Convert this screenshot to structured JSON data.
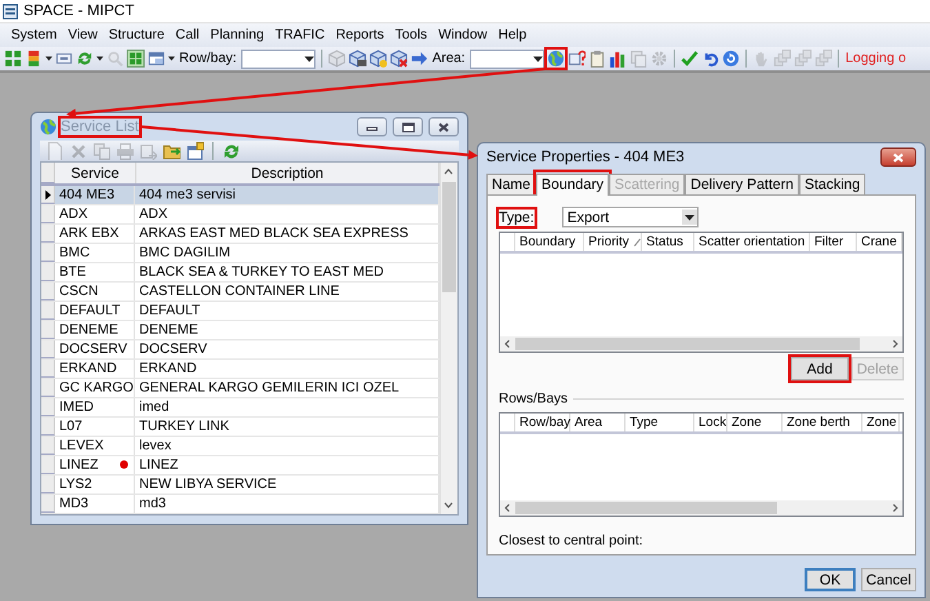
{
  "app": {
    "title": "SPACE - MIPCT"
  },
  "menu": [
    "System",
    "View",
    "Structure",
    "Call",
    "Planning",
    "TRAFIC",
    "Reports",
    "Tools",
    "Window",
    "Help"
  ],
  "toolbar": [
    {
      "kind": "icon",
      "disabled": false,
      "highlighted": false
    },
    {
      "kind": "icon",
      "disabled": false,
      "highlighted": false
    },
    {
      "kind": "caret"
    },
    {
      "kind": "icon",
      "disabled": false,
      "highlighted": false
    },
    {
      "kind": "icon",
      "disabled": false,
      "highlighted": false
    },
    {
      "kind": "caret"
    },
    {
      "kind": "icon",
      "disabled": true,
      "highlighted": false
    },
    {
      "kind": "icon",
      "disabled": false,
      "highlighted": false
    },
    {
      "kind": "icon",
      "disabled": false,
      "highlighted": false
    },
    {
      "kind": "caret"
    },
    {
      "kind": "label",
      "text": "Row/bay:"
    },
    {
      "kind": "combo"
    },
    {
      "kind": "separator"
    },
    {
      "kind": "icon",
      "disabled": true,
      "highlighted": false
    },
    {
      "kind": "icon",
      "disabled": false,
      "highlighted": false
    },
    {
      "kind": "icon",
      "disabled": false,
      "highlighted": false
    },
    {
      "kind": "icon",
      "disabled": false,
      "highlighted": false
    },
    {
      "kind": "icon",
      "disabled": false,
      "highlighted": false
    },
    {
      "kind": "label",
      "text": "Area:"
    },
    {
      "kind": "combo"
    },
    {
      "kind": "icon",
      "disabled": false,
      "highlighted": true
    },
    {
      "kind": "icon",
      "disabled": false,
      "highlighted": false
    },
    {
      "kind": "icon",
      "disabled": false,
      "highlighted": false
    },
    {
      "kind": "icon",
      "disabled": false,
      "highlighted": false
    },
    {
      "kind": "icon",
      "disabled": true,
      "highlighted": false
    },
    {
      "kind": "icon",
      "disabled": true,
      "highlighted": false
    },
    {
      "kind": "separator"
    },
    {
      "kind": "icon",
      "disabled": false,
      "highlighted": false
    },
    {
      "kind": "icon",
      "disabled": false,
      "highlighted": false
    },
    {
      "kind": "icon",
      "disabled": false,
      "highlighted": false
    },
    {
      "kind": "separator"
    },
    {
      "kind": "icon",
      "disabled": true,
      "highlighted": false
    },
    {
      "kind": "icon",
      "disabled": true,
      "highlighted": false
    },
    {
      "kind": "icon",
      "disabled": true,
      "highlighted": false
    },
    {
      "kind": "icon",
      "disabled": true,
      "highlighted": false
    },
    {
      "kind": "separator"
    },
    {
      "kind": "status",
      "text": "Logging o"
    }
  ],
  "service_list": {
    "title": "Service List",
    "title_highlighted": true,
    "toolbar": [
      {
        "kind": "icon",
        "disabled": true
      },
      {
        "kind": "icon",
        "disabled": true
      },
      {
        "kind": "icon",
        "disabled": true
      },
      {
        "kind": "icon",
        "disabled": true
      },
      {
        "kind": "icon",
        "disabled": true
      },
      {
        "kind": "icon",
        "disabled": false
      },
      {
        "kind": "icon",
        "disabled": false
      },
      {
        "kind": "separator"
      },
      {
        "kind": "icon",
        "disabled": false
      }
    ],
    "columns": [
      "Service",
      "Description"
    ],
    "rows": [
      {
        "service": "404 ME3",
        "description": "404 me3 servisi",
        "selected": true,
        "marked": false
      },
      {
        "service": "ADX",
        "description": "ADX",
        "selected": false,
        "marked": false
      },
      {
        "service": "ARK EBX",
        "description": "ARKAS EAST MED BLACK SEA EXPRESS",
        "selected": false,
        "marked": false
      },
      {
        "service": "BMC",
        "description": "BMC DAGILIM",
        "selected": false,
        "marked": false
      },
      {
        "service": "BTE",
        "description": "BLACK SEA & TURKEY TO EAST MED",
        "selected": false,
        "marked": false
      },
      {
        "service": "CSCN",
        "description": "CASTELLON CONTAINER LINE",
        "selected": false,
        "marked": false
      },
      {
        "service": "DEFAULT",
        "description": "DEFAULT",
        "selected": false,
        "marked": false
      },
      {
        "service": "DENEME",
        "description": "DENEME",
        "selected": false,
        "marked": false
      },
      {
        "service": "DOCSERV",
        "description": "DOCSERV",
        "selected": false,
        "marked": false
      },
      {
        "service": "ERKAND",
        "description": "ERKAND",
        "selected": false,
        "marked": false
      },
      {
        "service": "GC KARGO",
        "description": "GENERAL KARGO GEMILERIN ICI OZEL",
        "selected": false,
        "marked": false
      },
      {
        "service": "IMED",
        "description": "imed",
        "selected": false,
        "marked": false
      },
      {
        "service": "L07",
        "description": "TURKEY LINK",
        "selected": false,
        "marked": false
      },
      {
        "service": "LEVEX",
        "description": "levex",
        "selected": false,
        "marked": false
      },
      {
        "service": "LINEZ",
        "description": "LINEZ",
        "selected": false,
        "marked": true
      },
      {
        "service": "LYS2",
        "description": "NEW LIBYA SERVICE",
        "selected": false,
        "marked": false
      },
      {
        "service": "MD3",
        "description": "md3",
        "selected": false,
        "marked": false
      }
    ]
  },
  "service_properties": {
    "title": "Service Properties - 404 ME3",
    "tabs": [
      {
        "label": "Name",
        "selected": false,
        "disabled": false,
        "highlighted": false
      },
      {
        "label": "Boundary",
        "selected": true,
        "disabled": false,
        "highlighted": true
      },
      {
        "label": "Scattering",
        "selected": false,
        "disabled": true,
        "highlighted": false
      },
      {
        "label": "Delivery Pattern",
        "selected": false,
        "disabled": false,
        "highlighted": false
      },
      {
        "label": "Stacking",
        "selected": false,
        "disabled": false,
        "highlighted": false
      }
    ],
    "type_label": "Type:",
    "type_label_highlighted": true,
    "type_value": "Export",
    "boundary_columns": [
      {
        "label": "Boundary",
        "sorted": false
      },
      {
        "label": "Priority",
        "sorted": true
      },
      {
        "label": "Status",
        "sorted": false
      },
      {
        "label": "Scatter orientation",
        "sorted": false
      },
      {
        "label": "Filter",
        "sorted": false
      },
      {
        "label": "Crane",
        "sorted": false
      }
    ],
    "boundary_buttons": [
      {
        "label": "Add",
        "disabled": false,
        "highlighted": true
      },
      {
        "label": "Delete",
        "disabled": true,
        "highlighted": false
      }
    ],
    "rows_bays_title": "Rows/Bays",
    "rows_bays_columns": [
      "Row/bay",
      "Area",
      "Type",
      "Lock",
      "Zone",
      "Zone berth",
      "Zone"
    ],
    "closest_label": "Closest to central point:",
    "buttons": [
      {
        "label": "OK",
        "default": true
      },
      {
        "label": "Cancel",
        "default": false
      }
    ]
  }
}
